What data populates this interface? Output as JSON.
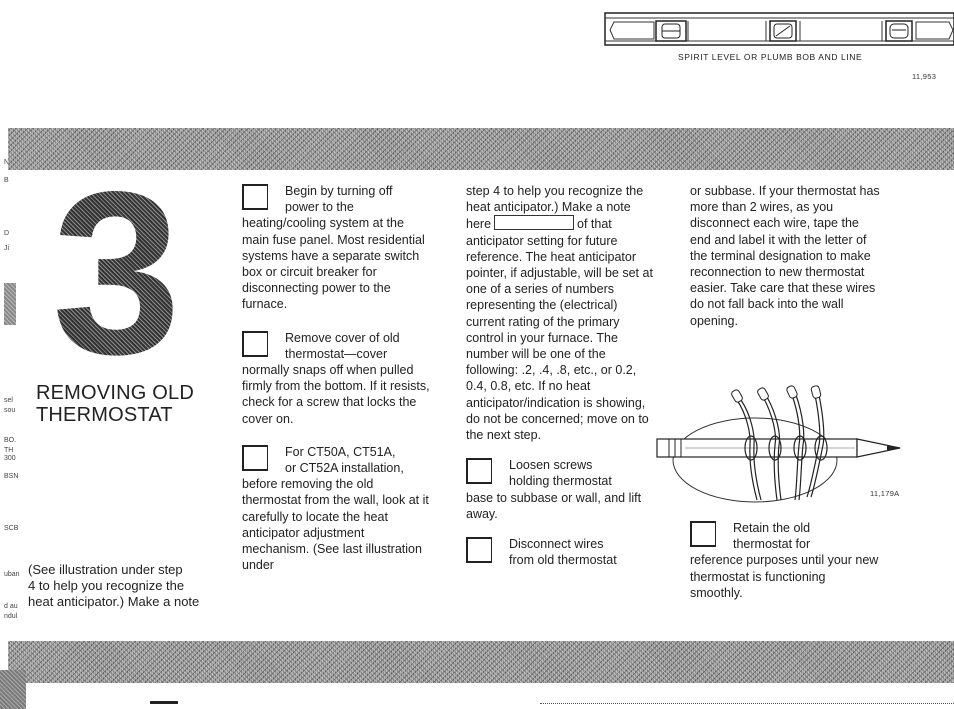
{
  "illustration_top": {
    "caption": "SPIRIT LEVEL OR PLUMB BOB AND LINE",
    "figure_number": "11,953"
  },
  "section": {
    "step_number": "3",
    "title_line1": "REMOVING OLD",
    "title_line2": "THERMOSTAT"
  },
  "left_column_note": {
    "line1": "(See illustration under step",
    "line2": "4 to help you recognize the",
    "line3": "heat anticipator.) Make a note"
  },
  "column1": {
    "steps": [
      {
        "lead1": "Begin by turning off",
        "lead2": "power to the",
        "body": "heating/cooling system at the main fuse panel. Most residential systems have a separate switch box or circuit breaker for disconnecting power to the furnace."
      },
      {
        "lead1": "Remove cover of old",
        "lead2": "thermostat—cover",
        "body": "normally snaps off when pulled firmly from the bottom. If it resists, check for a screw that locks the cover on."
      },
      {
        "lead1": "For CT50A, CT51A,",
        "lead2": "or CT52A installation,",
        "body": "before removing the old thermostat from the wall, look at it carefully to locate the heat anticipator adjustment mechanism. (See last illustration under"
      }
    ]
  },
  "column2": {
    "continuation_before_box": "step 4 to help you recognize the heat anticipator.) Make a note here",
    "continuation_after_box": "of that anticipator setting for future reference. The heat anticipator pointer, if adjustable, will be set at one of a series of numbers representing the (electrical) current rating of the primary control in your furnace. The number will be one of the following: .2, .4, .8, etc., or 0.2, 0.4, 0.8, etc. If no heat anticipator/indication is showing, do not be concerned; move on to the next step.",
    "steps": [
      {
        "lead1": "Loosen screws",
        "lead2": "holding thermostat",
        "body": "base to subbase or wall, and lift away."
      },
      {
        "lead1": "Disconnect wires",
        "lead2": "from old thermostat",
        "body": ""
      }
    ]
  },
  "column3": {
    "continuation": "or subbase. If your thermostat has more than 2 wires, as you disconnect each wire, tape the end and label it with the letter of the terminal designation to make reconnection to new thermostat easier. Take care that these wires do not fall back into the wall opening.",
    "figure_number": "11,179A",
    "steps": [
      {
        "lead1": "Retain the old",
        "lead2": "thermostat for",
        "body": "reference purposes until your new thermostat is functioning smoothly."
      }
    ]
  },
  "margin_fragments": [
    "N",
    "B",
    "D",
    "Ji",
    "sel",
    "sou",
    "BO.",
    "TH",
    "300",
    "BSN",
    "SCB",
    "uban",
    "d au",
    "ndul"
  ]
}
